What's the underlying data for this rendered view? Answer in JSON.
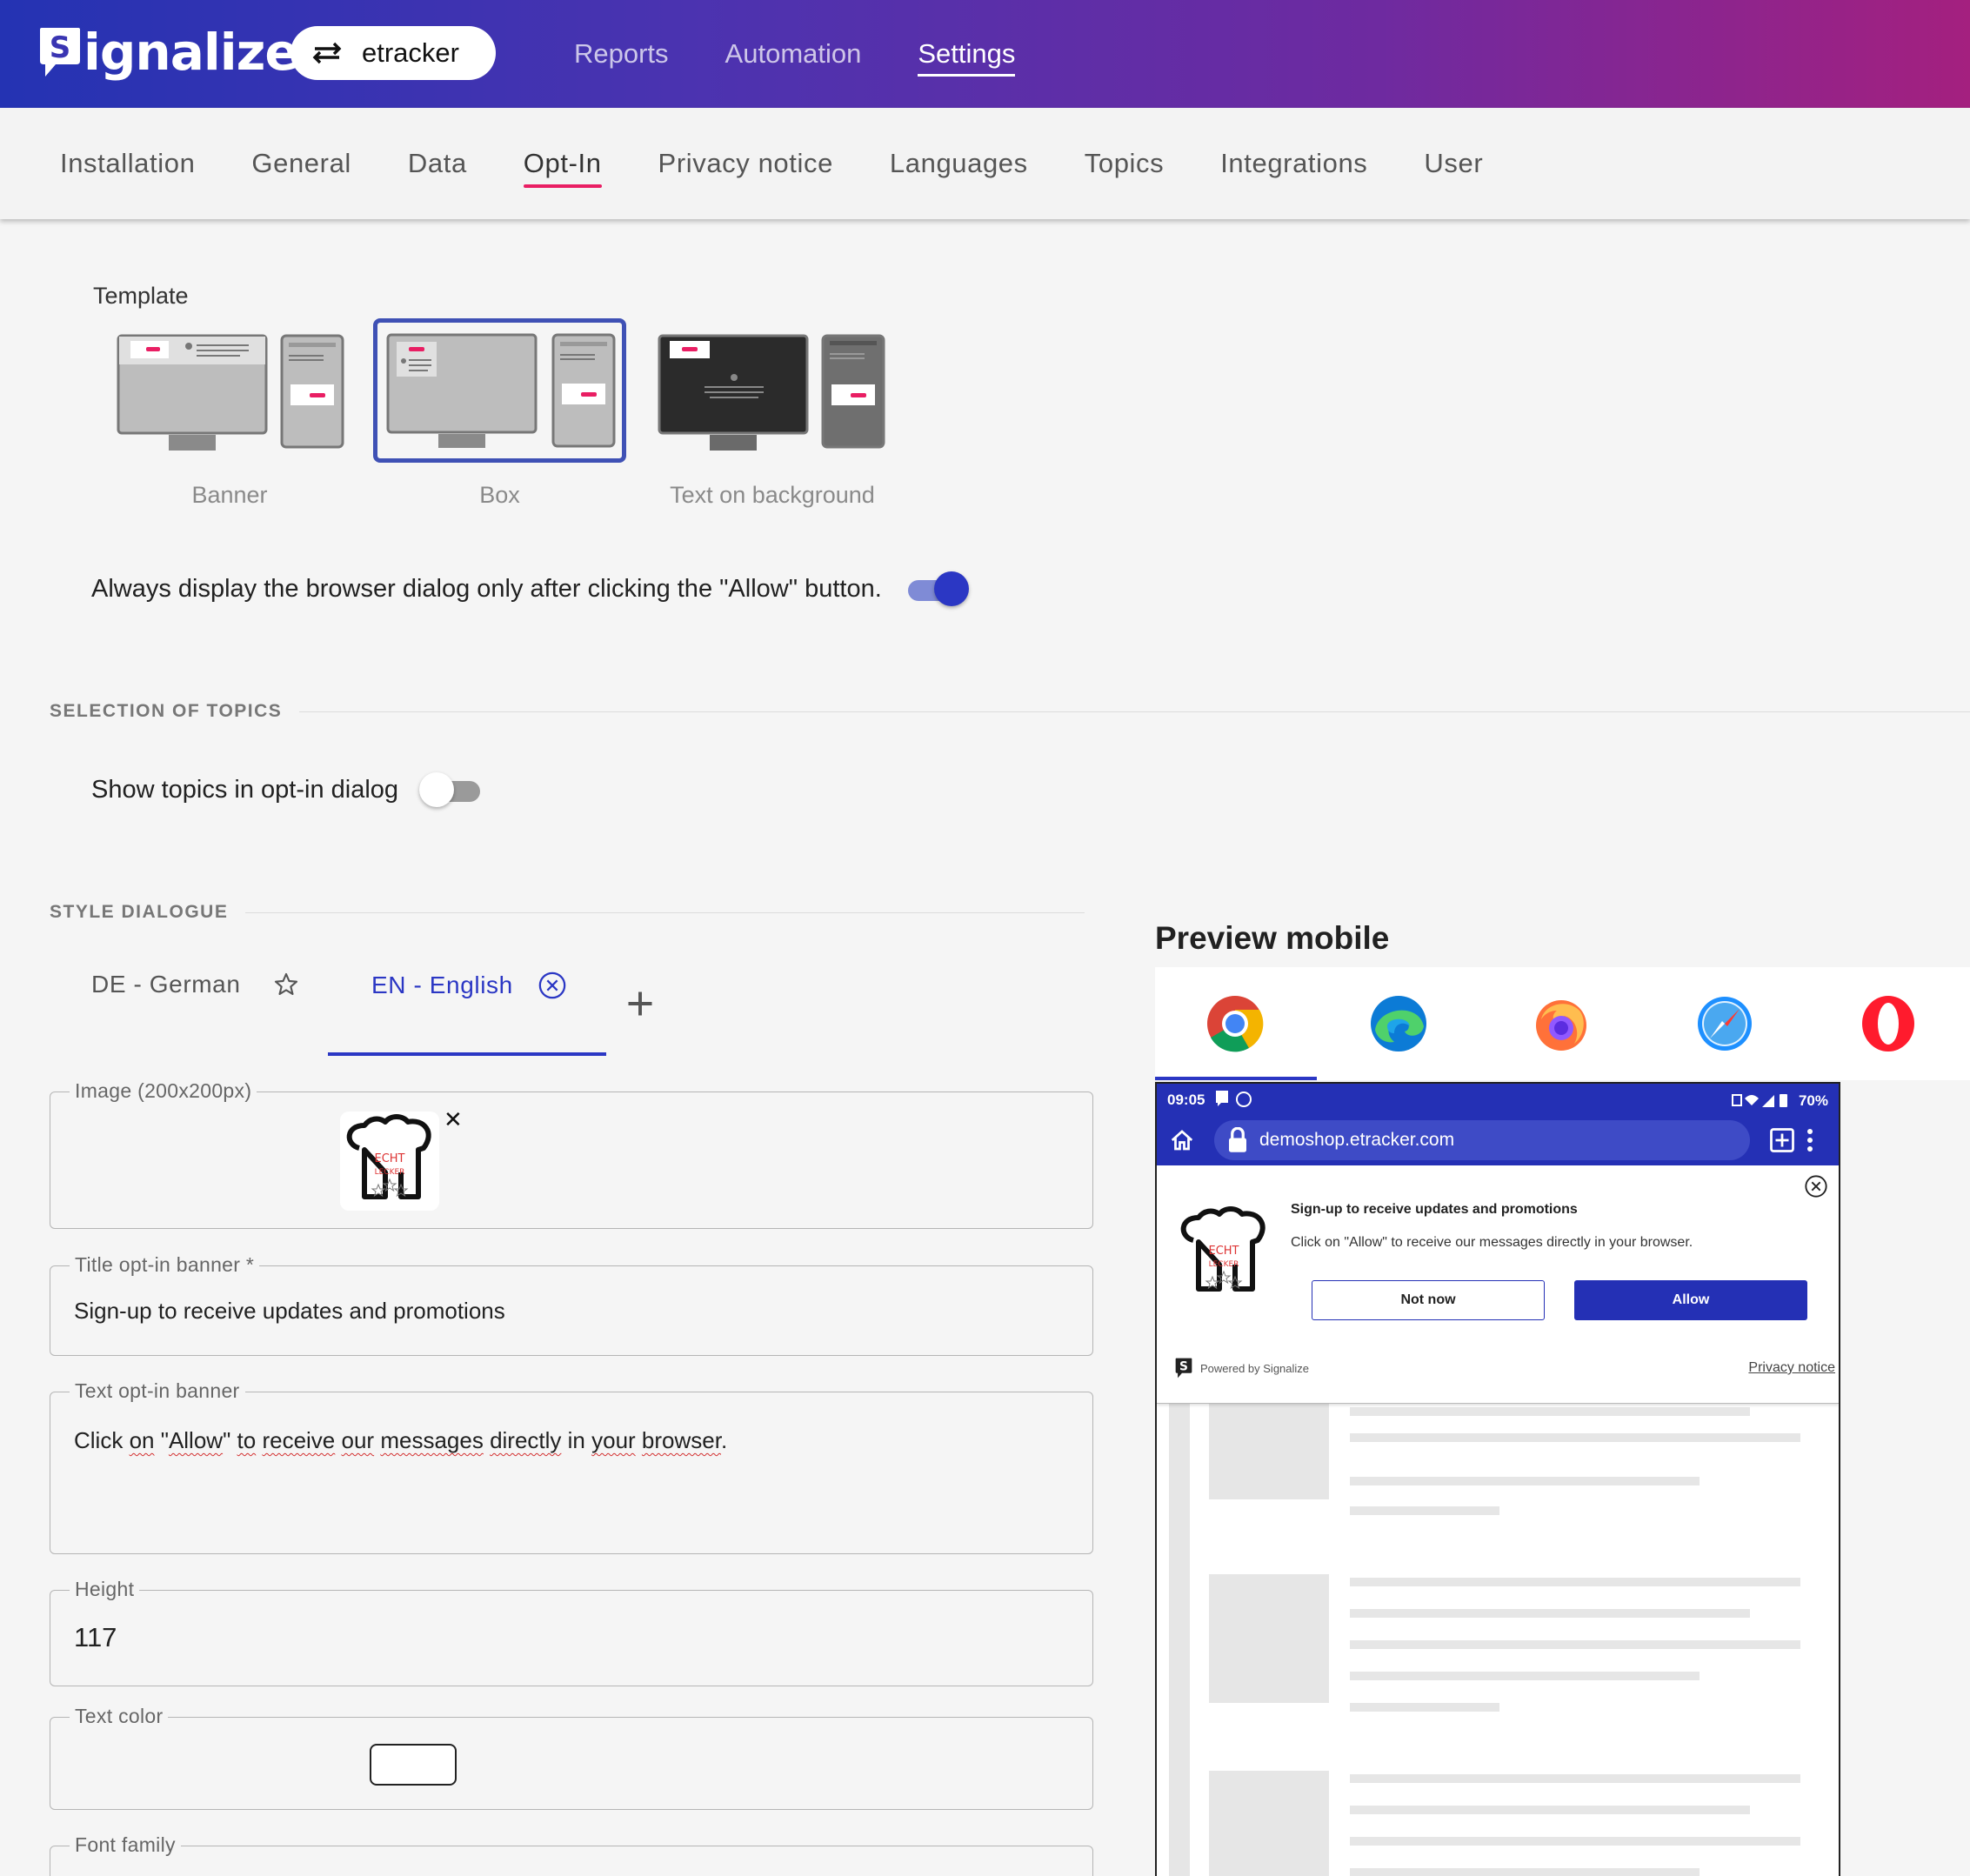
{
  "header": {
    "logo_text": "ignalize",
    "logo_letter": "S",
    "account": "etracker",
    "nav": [
      "Reports",
      "Automation",
      "Settings"
    ],
    "active_nav": "Settings"
  },
  "subnav": {
    "tabs": [
      "Installation",
      "General",
      "Data",
      "Opt-In",
      "Privacy notice",
      "Languages",
      "Topics",
      "Integrations",
      "User"
    ],
    "active": "Opt-In"
  },
  "template": {
    "label": "Template",
    "options": [
      "Banner",
      "Box",
      "Text on background"
    ],
    "selected": "Box"
  },
  "browser_dialog_toggle": {
    "label": "Always display the browser dialog only after clicking the \"Allow\" button.",
    "on": true
  },
  "topics_section": {
    "heading": "SELECTION OF TOPICS",
    "toggle_label": "Show topics in opt-in dialog",
    "on": false
  },
  "style_section": {
    "heading": "STYLE DIALOGUE",
    "languages": [
      {
        "label": "DE - German",
        "icon": "star-icon",
        "active": false
      },
      {
        "label": "EN - English",
        "icon": "cancel-circle-icon",
        "active": true
      }
    ],
    "image_field": {
      "label": "Image (200x200px)",
      "image_text": [
        "ECHT",
        "LECKER"
      ]
    },
    "title_field": {
      "label": "Title opt-in banner *",
      "value": "Sign-up to receive updates and promotions"
    },
    "text_field": {
      "label": "Text opt-in banner",
      "value_parts": [
        "Click ",
        "on",
        " \"",
        "Allow",
        "\" ",
        "to",
        " ",
        "receive",
        " ",
        "our",
        " ",
        "messages",
        " ",
        "directly",
        " in ",
        "your",
        " ",
        "browser",
        "."
      ]
    },
    "height_field": {
      "label": "Height",
      "value": "117"
    },
    "text_color_field": {
      "label": "Text color",
      "value": "#ffffff"
    },
    "font_family_field": {
      "label": "Font family"
    }
  },
  "preview": {
    "title": "Preview mobile",
    "browsers": [
      "chrome-icon",
      "edge-icon",
      "firefox-icon",
      "safari-icon",
      "opera-icon"
    ],
    "active_browser": "chrome-icon",
    "status": {
      "time": "09:05",
      "battery": "70%"
    },
    "url": "demoshop.etracker.com",
    "optin": {
      "title": "Sign-up to receive updates and promotions",
      "text": "Click on \"Allow\" to receive our messages directly in your browser.",
      "not_now": "Not now",
      "allow": "Allow",
      "powered": "Powered by Signalize",
      "privacy": "Privacy notice"
    }
  },
  "colors": {
    "accent": "#2b37c4",
    "pink_underline": "#e91e63",
    "header_start": "#2433b3",
    "header_end": "#a4207f"
  }
}
